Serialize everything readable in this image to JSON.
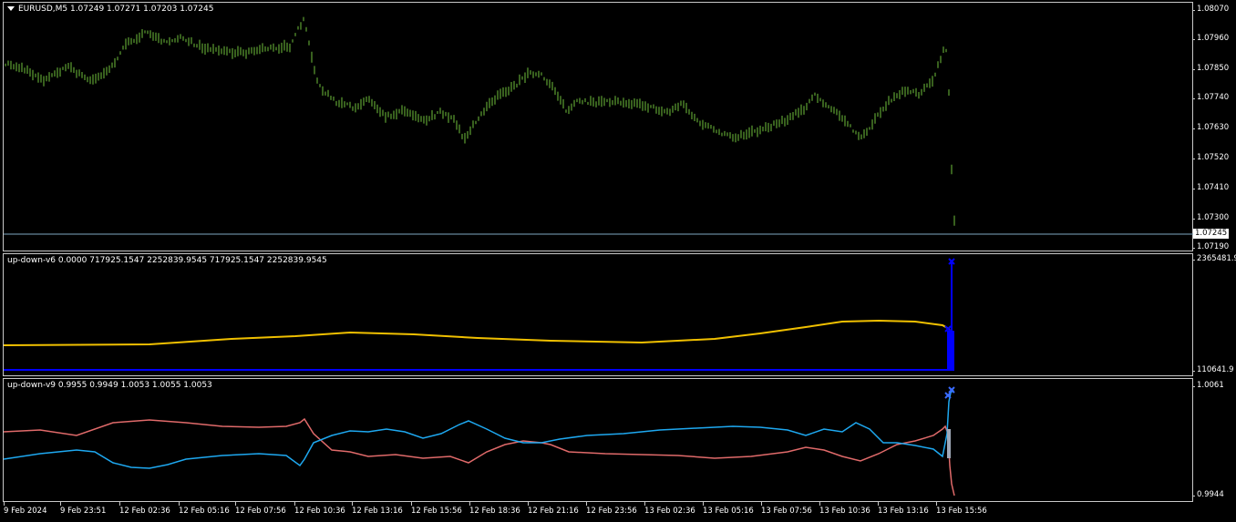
{
  "main_chart": {
    "title": "EURUSD,M5  1.07249 1.07271 1.07203 1.07245",
    "price_ticks": [
      "1.08070",
      "1.07960",
      "1.07850",
      "1.07740",
      "1.07630",
      "1.07520",
      "1.07410",
      "1.07300",
      "1.07190"
    ],
    "current_price": "1.07245",
    "colors": {
      "bars": "#6fbf3c",
      "price_line": "#7fa7c2"
    }
  },
  "indicator_1": {
    "title": "up-down-v6 0.0000 717925.1547 2252839.9545 717925.1547 2252839.9545",
    "axis_top": "2365481.9",
    "axis_bottom": "110641.9",
    "colors": {
      "yellow_line": "#f0c000",
      "blue_line": "#0000ff"
    }
  },
  "indicator_2": {
    "title": "up-down-v9 0.9955 0.9949 1.0053 1.0055 1.0053",
    "axis_top": "1.0061",
    "axis_bottom": "0.9944",
    "colors": {
      "red_line": "#e06a6a",
      "blue_line": "#1ea8f0"
    }
  },
  "time_axis": [
    "9 Feb 2024",
    "9 Feb 23:51",
    "12 Feb 02:36",
    "12 Feb 05:16",
    "12 Feb 07:56",
    "12 Feb 10:36",
    "12 Feb 13:16",
    "12 Feb 15:56",
    "12 Feb 18:36",
    "12 Feb 21:16",
    "12 Feb 23:56",
    "13 Feb 02:36",
    "13 Feb 05:16",
    "13 Feb 07:56",
    "13 Feb 10:36",
    "13 Feb 13:16",
    "13 Feb 15:56"
  ]
}
